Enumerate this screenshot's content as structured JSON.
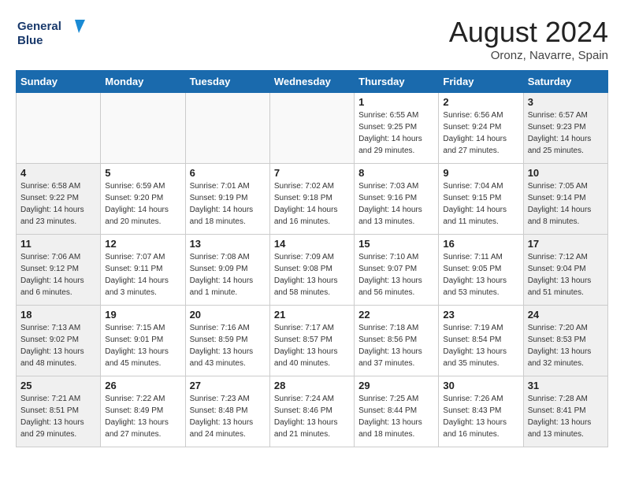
{
  "header": {
    "logo_line1": "General",
    "logo_line2": "Blue",
    "month": "August 2024",
    "location": "Oronz, Navarre, Spain"
  },
  "days_of_week": [
    "Sunday",
    "Monday",
    "Tuesday",
    "Wednesday",
    "Thursday",
    "Friday",
    "Saturday"
  ],
  "weeks": [
    [
      {
        "day": "",
        "info": "",
        "type": "empty"
      },
      {
        "day": "",
        "info": "",
        "type": "empty"
      },
      {
        "day": "",
        "info": "",
        "type": "empty"
      },
      {
        "day": "",
        "info": "",
        "type": "empty"
      },
      {
        "day": "1",
        "info": "Sunrise: 6:55 AM\nSunset: 9:25 PM\nDaylight: 14 hours\nand 29 minutes.",
        "type": "weekday"
      },
      {
        "day": "2",
        "info": "Sunrise: 6:56 AM\nSunset: 9:24 PM\nDaylight: 14 hours\nand 27 minutes.",
        "type": "weekday"
      },
      {
        "day": "3",
        "info": "Sunrise: 6:57 AM\nSunset: 9:23 PM\nDaylight: 14 hours\nand 25 minutes.",
        "type": "weekend"
      }
    ],
    [
      {
        "day": "4",
        "info": "Sunrise: 6:58 AM\nSunset: 9:22 PM\nDaylight: 14 hours\nand 23 minutes.",
        "type": "weekend"
      },
      {
        "day": "5",
        "info": "Sunrise: 6:59 AM\nSunset: 9:20 PM\nDaylight: 14 hours\nand 20 minutes.",
        "type": "weekday"
      },
      {
        "day": "6",
        "info": "Sunrise: 7:01 AM\nSunset: 9:19 PM\nDaylight: 14 hours\nand 18 minutes.",
        "type": "weekday"
      },
      {
        "day": "7",
        "info": "Sunrise: 7:02 AM\nSunset: 9:18 PM\nDaylight: 14 hours\nand 16 minutes.",
        "type": "weekday"
      },
      {
        "day": "8",
        "info": "Sunrise: 7:03 AM\nSunset: 9:16 PM\nDaylight: 14 hours\nand 13 minutes.",
        "type": "weekday"
      },
      {
        "day": "9",
        "info": "Sunrise: 7:04 AM\nSunset: 9:15 PM\nDaylight: 14 hours\nand 11 minutes.",
        "type": "weekday"
      },
      {
        "day": "10",
        "info": "Sunrise: 7:05 AM\nSunset: 9:14 PM\nDaylight: 14 hours\nand 8 minutes.",
        "type": "weekend"
      }
    ],
    [
      {
        "day": "11",
        "info": "Sunrise: 7:06 AM\nSunset: 9:12 PM\nDaylight: 14 hours\nand 6 minutes.",
        "type": "weekend"
      },
      {
        "day": "12",
        "info": "Sunrise: 7:07 AM\nSunset: 9:11 PM\nDaylight: 14 hours\nand 3 minutes.",
        "type": "weekday"
      },
      {
        "day": "13",
        "info": "Sunrise: 7:08 AM\nSunset: 9:09 PM\nDaylight: 14 hours\nand 1 minute.",
        "type": "weekday"
      },
      {
        "day": "14",
        "info": "Sunrise: 7:09 AM\nSunset: 9:08 PM\nDaylight: 13 hours\nand 58 minutes.",
        "type": "weekday"
      },
      {
        "day": "15",
        "info": "Sunrise: 7:10 AM\nSunset: 9:07 PM\nDaylight: 13 hours\nand 56 minutes.",
        "type": "weekday"
      },
      {
        "day": "16",
        "info": "Sunrise: 7:11 AM\nSunset: 9:05 PM\nDaylight: 13 hours\nand 53 minutes.",
        "type": "weekday"
      },
      {
        "day": "17",
        "info": "Sunrise: 7:12 AM\nSunset: 9:04 PM\nDaylight: 13 hours\nand 51 minutes.",
        "type": "weekend"
      }
    ],
    [
      {
        "day": "18",
        "info": "Sunrise: 7:13 AM\nSunset: 9:02 PM\nDaylight: 13 hours\nand 48 minutes.",
        "type": "weekend"
      },
      {
        "day": "19",
        "info": "Sunrise: 7:15 AM\nSunset: 9:01 PM\nDaylight: 13 hours\nand 45 minutes.",
        "type": "weekday"
      },
      {
        "day": "20",
        "info": "Sunrise: 7:16 AM\nSunset: 8:59 PM\nDaylight: 13 hours\nand 43 minutes.",
        "type": "weekday"
      },
      {
        "day": "21",
        "info": "Sunrise: 7:17 AM\nSunset: 8:57 PM\nDaylight: 13 hours\nand 40 minutes.",
        "type": "weekday"
      },
      {
        "day": "22",
        "info": "Sunrise: 7:18 AM\nSunset: 8:56 PM\nDaylight: 13 hours\nand 37 minutes.",
        "type": "weekday"
      },
      {
        "day": "23",
        "info": "Sunrise: 7:19 AM\nSunset: 8:54 PM\nDaylight: 13 hours\nand 35 minutes.",
        "type": "weekday"
      },
      {
        "day": "24",
        "info": "Sunrise: 7:20 AM\nSunset: 8:53 PM\nDaylight: 13 hours\nand 32 minutes.",
        "type": "weekend"
      }
    ],
    [
      {
        "day": "25",
        "info": "Sunrise: 7:21 AM\nSunset: 8:51 PM\nDaylight: 13 hours\nand 29 minutes.",
        "type": "weekend"
      },
      {
        "day": "26",
        "info": "Sunrise: 7:22 AM\nSunset: 8:49 PM\nDaylight: 13 hours\nand 27 minutes.",
        "type": "weekday"
      },
      {
        "day": "27",
        "info": "Sunrise: 7:23 AM\nSunset: 8:48 PM\nDaylight: 13 hours\nand 24 minutes.",
        "type": "weekday"
      },
      {
        "day": "28",
        "info": "Sunrise: 7:24 AM\nSunset: 8:46 PM\nDaylight: 13 hours\nand 21 minutes.",
        "type": "weekday"
      },
      {
        "day": "29",
        "info": "Sunrise: 7:25 AM\nSunset: 8:44 PM\nDaylight: 13 hours\nand 18 minutes.",
        "type": "weekday"
      },
      {
        "day": "30",
        "info": "Sunrise: 7:26 AM\nSunset: 8:43 PM\nDaylight: 13 hours\nand 16 minutes.",
        "type": "weekday"
      },
      {
        "day": "31",
        "info": "Sunrise: 7:28 AM\nSunset: 8:41 PM\nDaylight: 13 hours\nand 13 minutes.",
        "type": "weekend"
      }
    ]
  ]
}
